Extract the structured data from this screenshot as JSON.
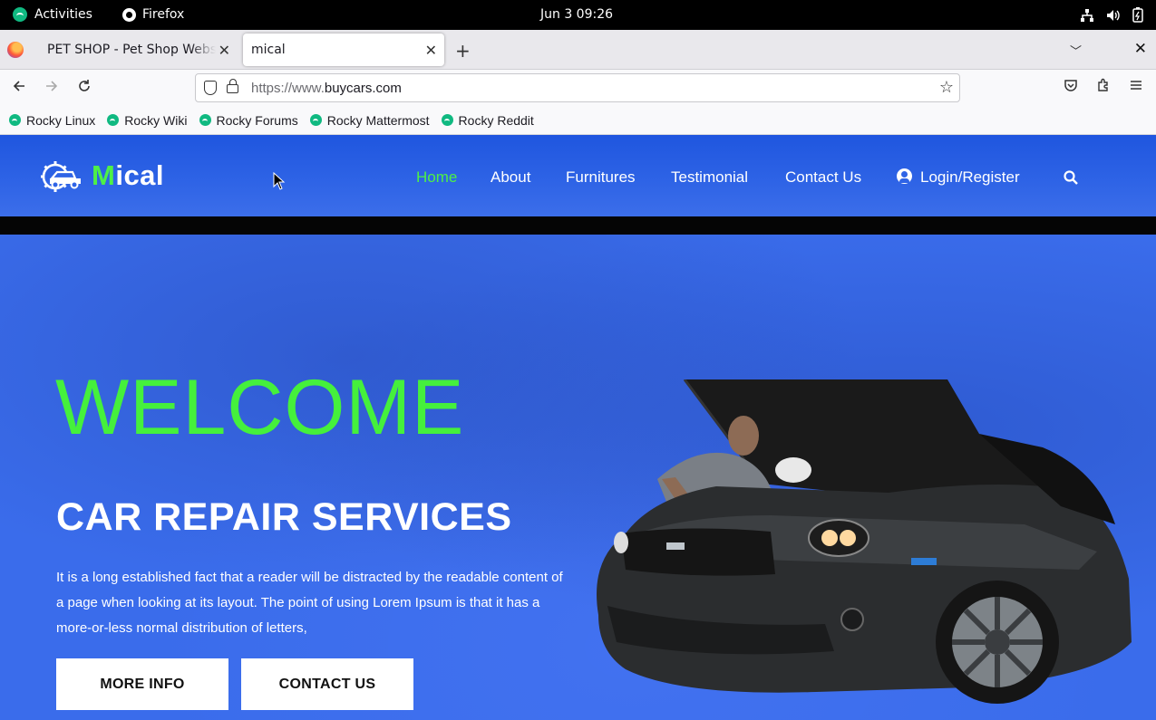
{
  "system": {
    "activities": "Activities",
    "app": "Firefox",
    "clock": "Jun 3  09:26"
  },
  "browser": {
    "tabs": [
      {
        "title": "PET SHOP - Pet Shop Website",
        "active": false
      },
      {
        "title": "mical",
        "active": true
      }
    ],
    "url_prefix": "https://www.",
    "url_domain": "buycars.com",
    "bookmarks": [
      "Rocky Linux",
      "Rocky Wiki",
      "Rocky Forums",
      "Rocky Mattermost",
      "Rocky Reddit"
    ]
  },
  "site": {
    "logo_first": "M",
    "logo_rest": "ical",
    "menu": [
      "Home",
      "About",
      "Furnitures",
      "Testimonial",
      "Contact Us"
    ],
    "login": "Login/Register",
    "hero": {
      "welcome": "WELCOME",
      "subtitle": "CAR REPAIR SERVICES",
      "description": "It is a long established fact that a reader will be distracted by the readable content of a page when looking at its layout. The point of using Lorem Ipsum is that it has a more-or-less normal distribution of letters,",
      "more_info": "MORE INFO",
      "contact_us": "CONTACT US"
    }
  },
  "colors": {
    "accent_green": "#45f03c",
    "site_blue": "#3a6ceb",
    "header_blue": "#1f56df"
  }
}
